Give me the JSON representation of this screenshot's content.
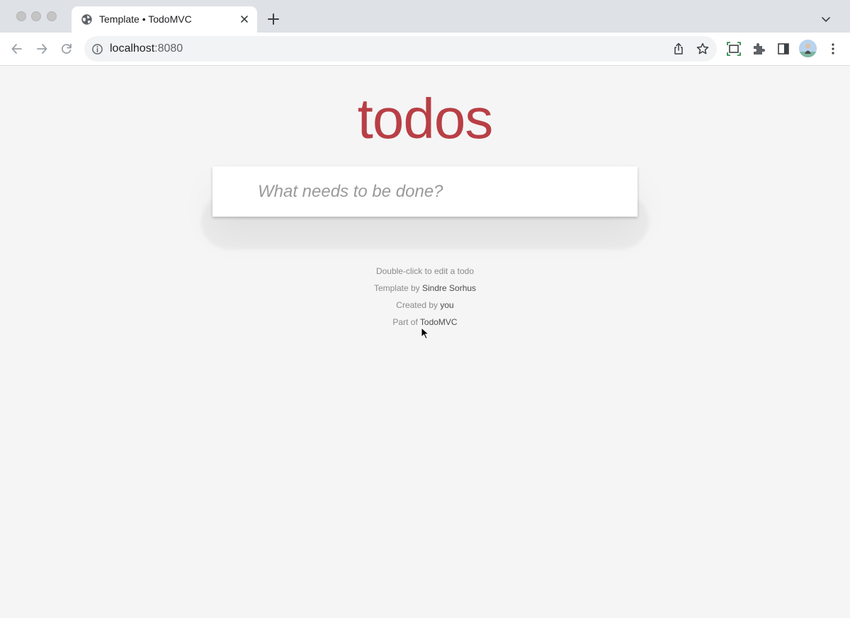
{
  "browser": {
    "tab_title": "Template • TodoMVC",
    "url_host": "localhost",
    "url_port": ":8080"
  },
  "app": {
    "title": "todos",
    "new_todo_placeholder": "What needs to be done?",
    "new_todo_value": "",
    "accent_color": "#b83f45"
  },
  "footer": {
    "hint": "Double-click to edit a todo",
    "template_prefix": "Template by ",
    "template_author": "Sindre Sorhus",
    "created_prefix": "Created by ",
    "created_author": "you",
    "part_prefix": "Part of ",
    "part_link": "TodoMVC"
  },
  "icons": {
    "tab": "globe-icon",
    "close": "close-icon",
    "new_tab": "plus-icon",
    "back": "back-arrow-icon",
    "forward": "forward-arrow-icon",
    "reload": "reload-icon",
    "info": "info-icon",
    "share": "share-icon",
    "bookmark": "star-icon",
    "capture": "screen-capture-icon",
    "extensions": "puzzle-icon",
    "side_panel": "side-panel-icon",
    "menu": "kebab-menu-icon"
  }
}
